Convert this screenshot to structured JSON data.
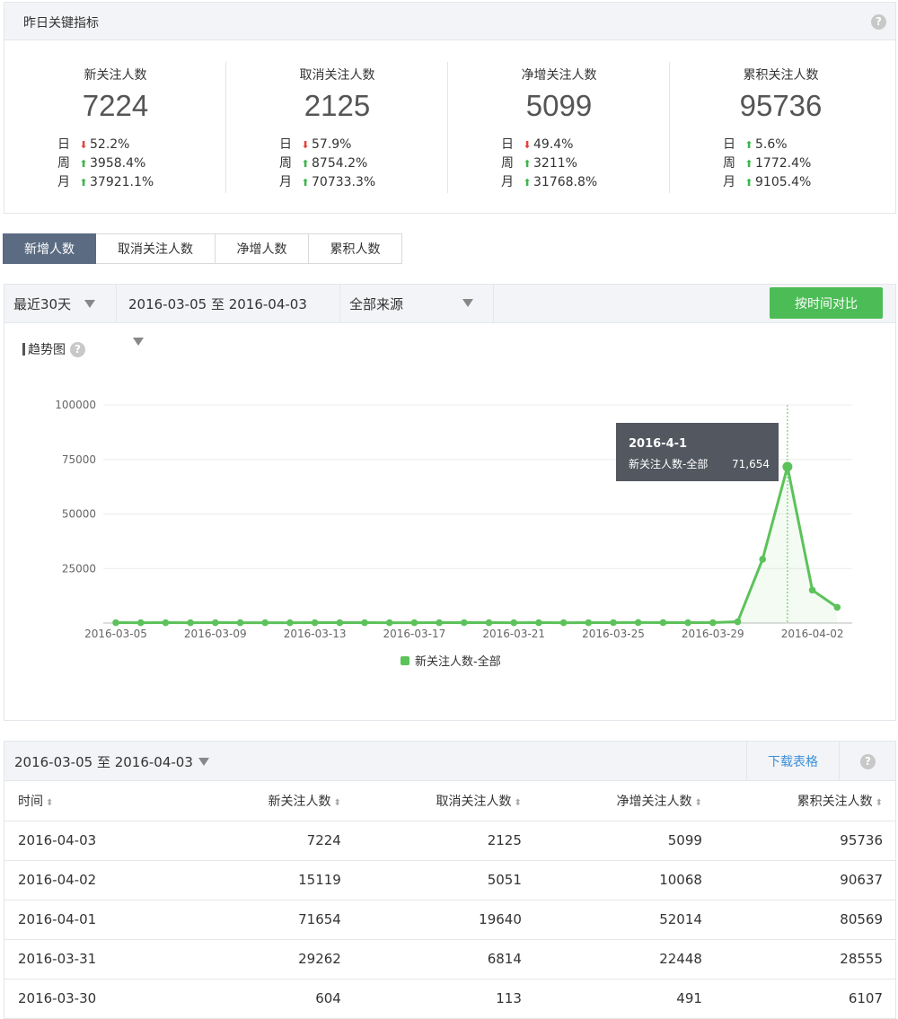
{
  "kpi": {
    "title": "昨日关键指标",
    "help": "?",
    "cards": [
      {
        "label": "新关注人数",
        "value": "7224",
        "rows": [
          {
            "period": "日",
            "dir": "down",
            "pct": "52.2%"
          },
          {
            "period": "周",
            "dir": "up",
            "pct": "3958.4%"
          },
          {
            "period": "月",
            "dir": "up",
            "pct": "37921.1%"
          }
        ]
      },
      {
        "label": "取消关注人数",
        "value": "2125",
        "rows": [
          {
            "period": "日",
            "dir": "down",
            "pct": "57.9%"
          },
          {
            "period": "周",
            "dir": "up",
            "pct": "8754.2%"
          },
          {
            "period": "月",
            "dir": "up",
            "pct": "70733.3%"
          }
        ]
      },
      {
        "label": "净增关注人数",
        "value": "5099",
        "rows": [
          {
            "period": "日",
            "dir": "down",
            "pct": "49.4%"
          },
          {
            "period": "周",
            "dir": "up",
            "pct": "3211%"
          },
          {
            "period": "月",
            "dir": "up",
            "pct": "31768.8%"
          }
        ]
      },
      {
        "label": "累积关注人数",
        "value": "95736",
        "rows": [
          {
            "period": "日",
            "dir": "up",
            "pct": "5.6%"
          },
          {
            "period": "周",
            "dir": "up",
            "pct": "1772.4%"
          },
          {
            "period": "月",
            "dir": "up",
            "pct": "9105.4%"
          }
        ]
      }
    ]
  },
  "tabs": [
    "新增人数",
    "取消关注人数",
    "净增人数",
    "累积人数"
  ],
  "filters": {
    "period": "最近30天",
    "date_range": "2016-03-05 至 2016-04-03",
    "source": "全部来源",
    "compare_button": "按时间对比"
  },
  "trend_label": "趋势图",
  "colors": {
    "accent_green": "#4cbd56",
    "line_green": "#5cc25a",
    "down_red": "#e3423f",
    "tab_active": "#5a6b82",
    "link_blue": "#3b8fd8"
  },
  "chart_data": {
    "type": "line",
    "x": [
      "2016-03-05",
      "2016-03-06",
      "2016-03-07",
      "2016-03-08",
      "2016-03-09",
      "2016-03-10",
      "2016-03-11",
      "2016-03-12",
      "2016-03-13",
      "2016-03-14",
      "2016-03-15",
      "2016-03-16",
      "2016-03-17",
      "2016-03-18",
      "2016-03-19",
      "2016-03-20",
      "2016-03-21",
      "2016-03-22",
      "2016-03-23",
      "2016-03-24",
      "2016-03-25",
      "2016-03-26",
      "2016-03-27",
      "2016-03-28",
      "2016-03-29",
      "2016-03-30",
      "2016-03-31",
      "2016-04-01",
      "2016-04-02",
      "2016-04-03"
    ],
    "series": [
      {
        "name": "新关注人数-全部",
        "values": [
          190,
          180,
          200,
          170,
          190,
          185,
          175,
          180,
          195,
          200,
          190,
          185,
          180,
          200,
          210,
          190,
          180,
          195,
          185,
          200,
          210,
          250,
          220,
          190,
          200,
          604,
          29262,
          71654,
          15119,
          7224
        ]
      }
    ],
    "x_tick_labels": [
      "2016-03-05",
      "2016-03-09",
      "2016-03-13",
      "2016-03-17",
      "2016-03-21",
      "2016-03-25",
      "2016-03-29",
      "2016-04-02"
    ],
    "y_ticks": [
      25000,
      50000,
      75000,
      100000
    ],
    "y_tick_labels": [
      "25000",
      "50000",
      "75000",
      "100000"
    ],
    "ylim": [
      0,
      100000
    ],
    "grid": true,
    "legend": "bottom",
    "tooltip": {
      "title": "2016-4-1",
      "series": "新关注人数-全部",
      "value": "71,654",
      "x": "2016-04-01"
    }
  },
  "table": {
    "range": "2016-03-05 至 2016-04-03",
    "download": "下载表格",
    "help": "?",
    "sort_glyph": "⬍",
    "columns": [
      "时间",
      "新关注人数",
      "取消关注人数",
      "净增关注人数",
      "累积关注人数"
    ],
    "rows": [
      [
        "2016-04-03",
        "7224",
        "2125",
        "5099",
        "95736"
      ],
      [
        "2016-04-02",
        "15119",
        "5051",
        "10068",
        "90637"
      ],
      [
        "2016-04-01",
        "71654",
        "19640",
        "52014",
        "80569"
      ],
      [
        "2016-03-31",
        "29262",
        "6814",
        "22448",
        "28555"
      ],
      [
        "2016-03-30",
        "604",
        "113",
        "491",
        "6107"
      ]
    ]
  }
}
